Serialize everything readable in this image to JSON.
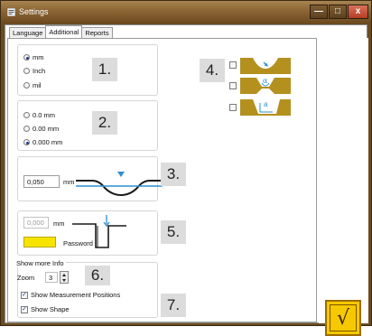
{
  "window": {
    "title": "Settings",
    "controls": {
      "minimize": "—",
      "maximize": "□",
      "close": "x"
    }
  },
  "tabs": [
    {
      "label": "Language",
      "active": false
    },
    {
      "label": "Additional",
      "active": true
    },
    {
      "label": "Reports",
      "active": false
    }
  ],
  "units": {
    "options": [
      "mm",
      "Inch",
      "mil"
    ],
    "selected": "mm",
    "tag": "1."
  },
  "precision": {
    "options": [
      "0.0 mm",
      "0.00 mm",
      "0.000 mm"
    ],
    "selected": "0.000 mm",
    "tag": "2."
  },
  "tolerance": {
    "value": "0,050",
    "unit": "mm",
    "tag": "3."
  },
  "password_group": {
    "value": "0,000",
    "unit": "mm",
    "password_label": "Password",
    "tag": "5."
  },
  "info": {
    "legend": "Show more Info",
    "zoom_label": "Zoom",
    "zoom_value": "3",
    "tag": "6.",
    "show_measurement_positions": "Show Measurement Positions",
    "show_shape": "Show Shape",
    "tag2": "7."
  },
  "shapes": {
    "tag": "4.",
    "items": [
      {
        "symbol": ""
      },
      {
        "symbol": "α"
      },
      {
        "symbol": "a"
      }
    ]
  },
  "ok_button": {
    "symbol": "√"
  },
  "colors": {
    "accent": "#f6c800",
    "titlebar": "#8a6434",
    "diagram_blue": "#2d8fd0",
    "tile": "#b4901e"
  }
}
